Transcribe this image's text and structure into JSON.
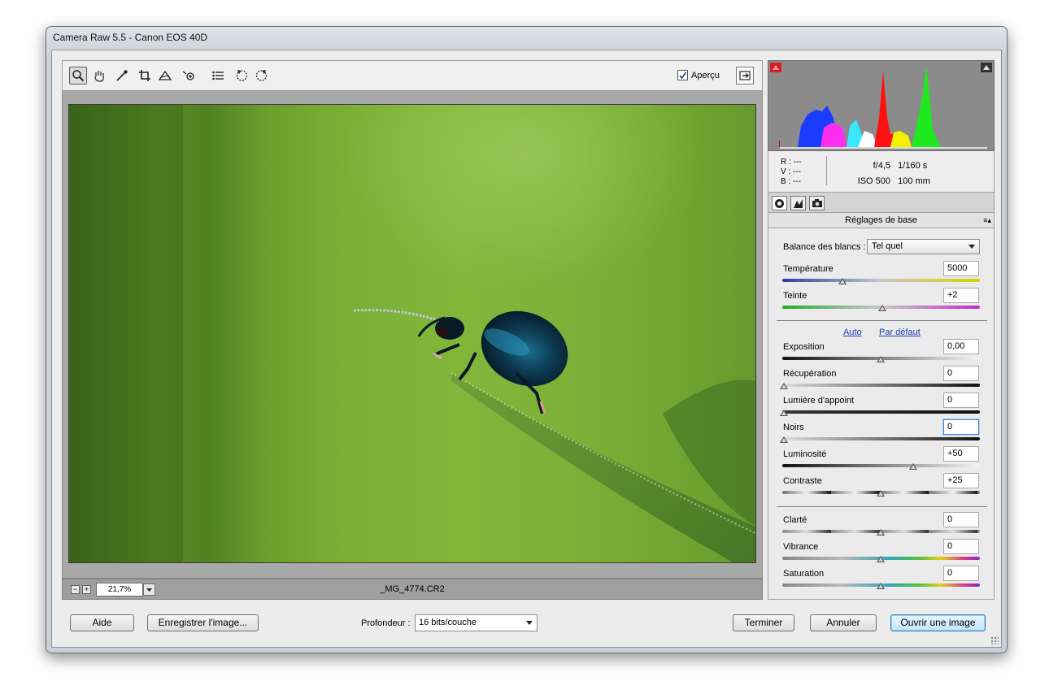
{
  "window": {
    "title": "Camera Raw 5.5  -  Canon EOS 40D"
  },
  "toolbar": {
    "tools": [
      "zoom-icon",
      "hand-icon",
      "white-balance-icon",
      "crop-icon",
      "straighten-icon",
      "red-eye-icon",
      "preferences-icon",
      "rotate-left-icon",
      "rotate-right-icon"
    ],
    "preview_label": "Aperçu",
    "preview_checked": true
  },
  "preview": {
    "zoom": "21,7%",
    "filename": "_MG_4774.CR2"
  },
  "info": {
    "r_label": "R :",
    "r_value": "---",
    "v_label": "V :",
    "v_value": "---",
    "b_label": "B :",
    "b_value": "---",
    "aperture": "f/4,5",
    "shutter": "1/160 s",
    "iso": "ISO 500",
    "focal": "100 mm"
  },
  "panel": {
    "title": "Réglages de base",
    "wb_label": "Balance des blancs :",
    "wb_value": "Tel quel",
    "auto_link": "Auto",
    "default_link": "Par défaut",
    "sliders": [
      {
        "label": "Température",
        "value": "5000",
        "pos": 0.3
      },
      {
        "label": "Teinte",
        "value": "+2",
        "pos": 0.505
      },
      {
        "label": "Exposition",
        "value": "0,00",
        "pos": 0.5
      },
      {
        "label": "Récupération",
        "value": "0",
        "pos": 0.0
      },
      {
        "label": "Lumière d'appoint",
        "value": "0",
        "pos": 0.0
      },
      {
        "label": "Noirs",
        "value": "0",
        "pos": 0.0
      },
      {
        "label": "Luminosité",
        "value": "+50",
        "pos": 0.66
      },
      {
        "label": "Contraste",
        "value": "+25",
        "pos": 0.5
      },
      {
        "label": "Clarté",
        "value": "0",
        "pos": 0.5
      },
      {
        "label": "Vibrance",
        "value": "0",
        "pos": 0.5
      },
      {
        "label": "Saturation",
        "value": "0",
        "pos": 0.5
      }
    ]
  },
  "footer": {
    "help": "Aide",
    "save": "Enregistrer l'image...",
    "depth_label": "Profondeur :",
    "depth_value": "16 bits/couche",
    "done": "Terminer",
    "cancel": "Annuler",
    "open": "Ouvrir une image"
  },
  "colors": {
    "accent": "#3c8ad8",
    "link": "#1f3fb0"
  }
}
